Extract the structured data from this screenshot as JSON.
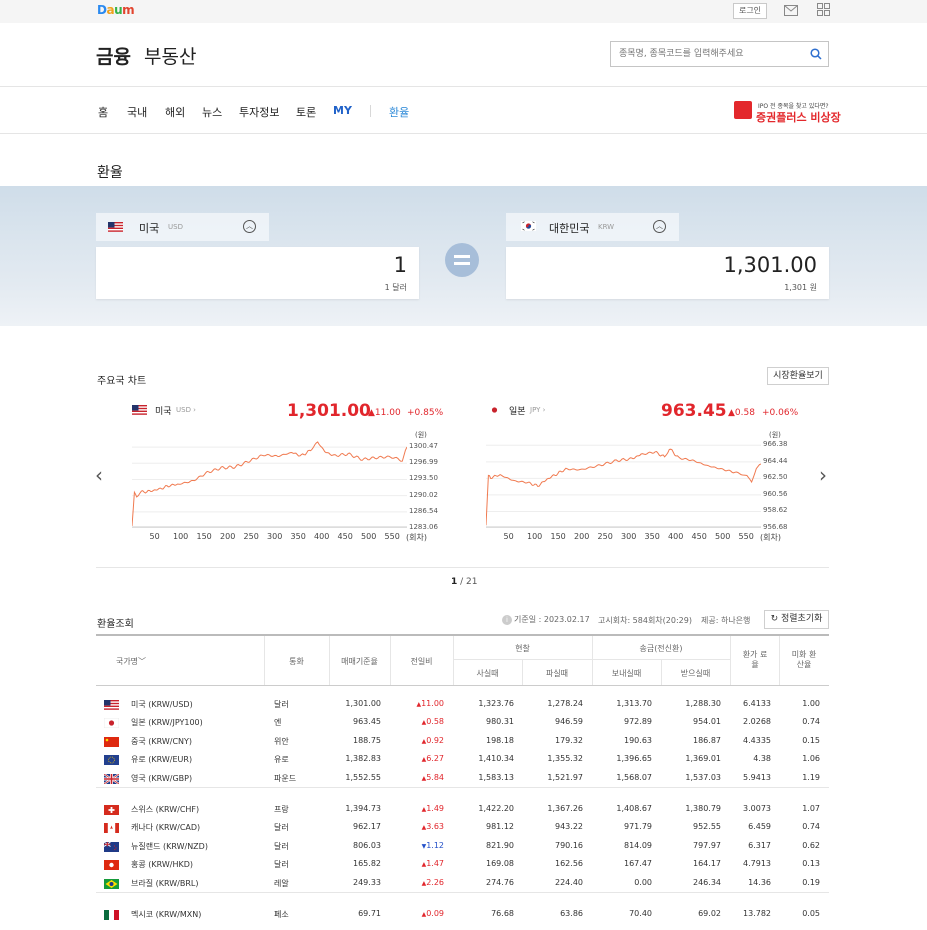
{
  "topbar": {
    "logo": "Daum",
    "login": "로그인"
  },
  "header": {
    "brand_main": "금융",
    "brand_sub": "부동산",
    "search_placeholder": "종목명, 종목코드를 입력해주세요"
  },
  "nav": {
    "items": [
      "홈",
      "국내",
      "해외",
      "뉴스",
      "투자정보",
      "토론",
      "MY",
      "환율"
    ],
    "promo_small": "IPO 전 종목을 찾고 있다면?",
    "promo_big": "증권플러스 비상장"
  },
  "page_title": "환율",
  "converter": {
    "from": {
      "name": "미국",
      "code": "USD",
      "value": "1",
      "unit": "1 달러"
    },
    "to": {
      "name": "대한민국",
      "code": "KRW",
      "value": "1,301.00",
      "unit": "1,301 원"
    }
  },
  "charts_section": {
    "title": "주요국 차트",
    "button": "시장환율보기",
    "pager_current": "1",
    "pager_total": "/ 21"
  },
  "chart_data": [
    {
      "type": "line",
      "title": "미국 USD",
      "price": "1,301.00",
      "diff": "▲11.00",
      "pct": "+0.85%",
      "yunit": "(원)",
      "xunit": "(회차)",
      "yticks": [
        "1300.47",
        "1296.99",
        "1293.50",
        "1290.02",
        "1286.54",
        "1283.06"
      ],
      "xticks": [
        "50",
        "100",
        "150",
        "200",
        "250",
        "300",
        "350",
        "400",
        "450",
        "500",
        "550"
      ],
      "ylim": [
        1283.06,
        1302.0
      ],
      "x": [
        0,
        5,
        10,
        20,
        40,
        60,
        80,
        100,
        130,
        160,
        190,
        220,
        250,
        280,
        310,
        340,
        360,
        380,
        395,
        410,
        430,
        460,
        490,
        520,
        550,
        575,
        585
      ],
      "y": [
        1283.5,
        1290.5,
        1290.0,
        1290.8,
        1291.0,
        1291.5,
        1292.2,
        1292.5,
        1293.2,
        1295.0,
        1296.0,
        1296.2,
        1297.5,
        1298.8,
        1298.5,
        1299.3,
        1298.6,
        1299.8,
        1301.6,
        1299.5,
        1298.6,
        1299.0,
        1297.8,
        1298.2,
        1298.4,
        1297.6,
        1300.5
      ]
    },
    {
      "type": "line",
      "title": "일본 JPY",
      "price": "963.45",
      "diff": "▲0.58",
      "pct": "+0.06%",
      "yunit": "(원)",
      "xunit": "(회차)",
      "yticks": [
        "966.38",
        "964.44",
        "962.50",
        "960.56",
        "958.62",
        "956.68"
      ],
      "xticks": [
        "50",
        "100",
        "150",
        "200",
        "250",
        "300",
        "350",
        "400",
        "450",
        "500",
        "550"
      ],
      "ylim": [
        956.68,
        967.0
      ],
      "x": [
        0,
        5,
        10,
        30,
        60,
        90,
        110,
        130,
        150,
        170,
        200,
        240,
        280,
        310,
        330,
        360,
        380,
        390,
        410,
        440,
        470,
        500,
        530,
        555,
        565,
        575,
        585
      ],
      "y": [
        957.0,
        962.8,
        962.6,
        962.9,
        962.2,
        962.0,
        961.6,
        962.4,
        963.0,
        963.6,
        963.5,
        964.0,
        964.6,
        964.8,
        965.3,
        965.6,
        965.0,
        966.0,
        964.9,
        964.6,
        964.0,
        963.6,
        963.2,
        962.8,
        962.0,
        963.8,
        964.2
      ]
    }
  ],
  "table": {
    "title": "환율조회",
    "info": "기준일 : 2023.02.17",
    "notice": "고시회차: 584회차(20:29)",
    "provider": "제공: 하나은행",
    "reset": "정렬초기화",
    "headers": {
      "country": "국가명",
      "currency": "통화",
      "base": "매매기준율",
      "change": "전일비",
      "cash": "현찰",
      "cash_buy": "사실때",
      "cash_sell": "파실때",
      "wire": "송금(전신환)",
      "wire_send": "보내실때",
      "wire_recv": "받으실때",
      "rate": "환가 료율",
      "usd": "미화 환산율"
    },
    "groups": [
      [
        {
          "flag": "us",
          "name": "미국 (KRW/USD)",
          "cur": "달러",
          "base": "1,301.00",
          "dir": "up",
          "chg": "11.00",
          "cb": "1,323.76",
          "cs": "1,278.24",
          "ws": "1,313.70",
          "wr": "1,288.30",
          "rate": "6.4133",
          "usd": "1.00"
        },
        {
          "flag": "jp",
          "name": "일본 (KRW/JPY100)",
          "cur": "엔",
          "base": "963.45",
          "dir": "up",
          "chg": "0.58",
          "cb": "980.31",
          "cs": "946.59",
          "ws": "972.89",
          "wr": "954.01",
          "rate": "2.0268",
          "usd": "0.74"
        },
        {
          "flag": "cn",
          "name": "중국 (KRW/CNY)",
          "cur": "위안",
          "base": "188.75",
          "dir": "up",
          "chg": "0.92",
          "cb": "198.18",
          "cs": "179.32",
          "ws": "190.63",
          "wr": "186.87",
          "rate": "4.4335",
          "usd": "0.15"
        },
        {
          "flag": "eu",
          "name": "유로 (KRW/EUR)",
          "cur": "유로",
          "base": "1,382.83",
          "dir": "up",
          "chg": "6.27",
          "cb": "1,410.34",
          "cs": "1,355.32",
          "ws": "1,396.65",
          "wr": "1,369.01",
          "rate": "4.38",
          "usd": "1.06"
        },
        {
          "flag": "gb",
          "name": "영국 (KRW/GBP)",
          "cur": "파운드",
          "base": "1,552.55",
          "dir": "up",
          "chg": "5.84",
          "cb": "1,583.13",
          "cs": "1,521.97",
          "ws": "1,568.07",
          "wr": "1,537.03",
          "rate": "5.9413",
          "usd": "1.19"
        }
      ],
      [
        {
          "flag": "ch",
          "name": "스위스 (KRW/CHF)",
          "cur": "프랑",
          "base": "1,394.73",
          "dir": "up",
          "chg": "1.49",
          "cb": "1,422.20",
          "cs": "1,367.26",
          "ws": "1,408.67",
          "wr": "1,380.79",
          "rate": "3.0073",
          "usd": "1.07"
        },
        {
          "flag": "ca",
          "name": "캐나다 (KRW/CAD)",
          "cur": "달러",
          "base": "962.17",
          "dir": "up",
          "chg": "3.63",
          "cb": "981.12",
          "cs": "943.22",
          "ws": "971.79",
          "wr": "952.55",
          "rate": "6.459",
          "usd": "0.74"
        },
        {
          "flag": "nz",
          "name": "뉴질랜드 (KRW/NZD)",
          "cur": "달러",
          "base": "806.03",
          "dir": "down",
          "chg": "1.12",
          "cb": "821.90",
          "cs": "790.16",
          "ws": "814.09",
          "wr": "797.97",
          "rate": "6.317",
          "usd": "0.62"
        },
        {
          "flag": "hk",
          "name": "홍콩 (KRW/HKD)",
          "cur": "달러",
          "base": "165.82",
          "dir": "up",
          "chg": "1.47",
          "cb": "169.08",
          "cs": "162.56",
          "ws": "167.47",
          "wr": "164.17",
          "rate": "4.7913",
          "usd": "0.13"
        },
        {
          "flag": "br",
          "name": "브라질 (KRW/BRL)",
          "cur": "레알",
          "base": "249.33",
          "dir": "up",
          "chg": "2.26",
          "cb": "274.76",
          "cs": "224.40",
          "ws": "0.00",
          "wr": "246.34",
          "rate": "14.36",
          "usd": "0.19"
        }
      ],
      [
        {
          "flag": "mx",
          "name": "멕시코 (KRW/MXN)",
          "cur": "페소",
          "base": "69.71",
          "dir": "up",
          "chg": "0.09",
          "cb": "76.68",
          "cs": "63.86",
          "ws": "70.40",
          "wr": "69.02",
          "rate": "13.782",
          "usd": "0.05"
        }
      ]
    ]
  },
  "colors": {
    "up": "#e1262c",
    "down": "#2451c9",
    "chart_line": "#f07a50",
    "accent": "#2e8ad8"
  }
}
